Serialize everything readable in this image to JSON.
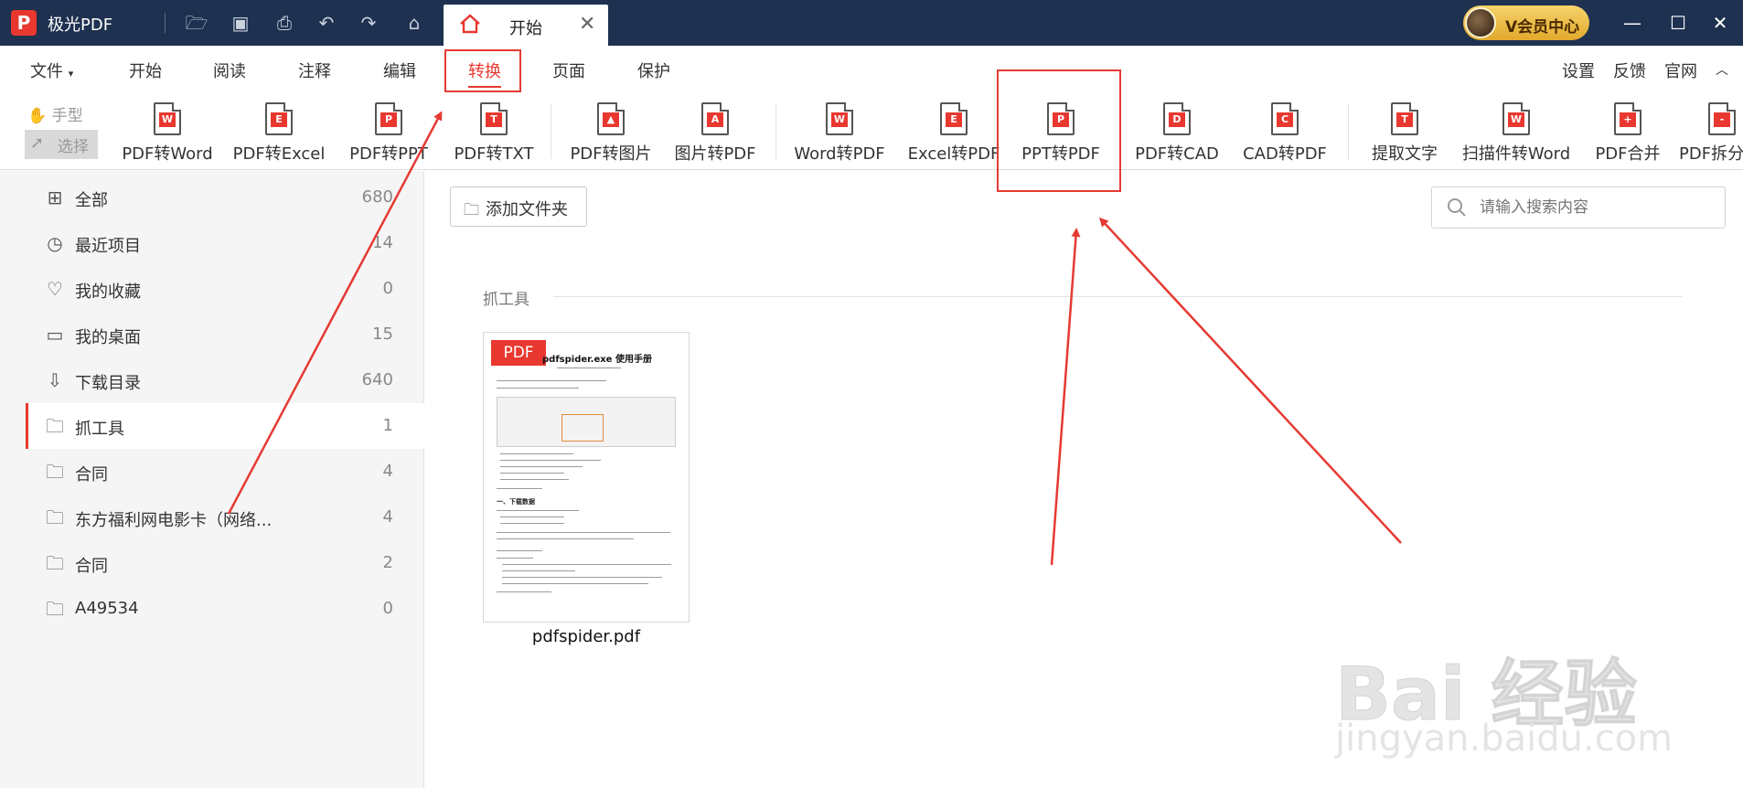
{
  "app": {
    "name": "极光PDF",
    "logo": "P"
  },
  "tabs": [
    {
      "label": "开始",
      "close": "✕"
    }
  ],
  "vip": {
    "label": "会员中心",
    "prefix": "V"
  },
  "menu": {
    "items": [
      "文件",
      "开始",
      "阅读",
      "注释",
      "编辑",
      "转换",
      "页面",
      "保护"
    ],
    "active": "转换",
    "right": [
      "设置",
      "反馈",
      "官网"
    ]
  },
  "toolbar": {
    "hand": "手型",
    "select": "选择",
    "tools": [
      {
        "label": "PDF转Word",
        "badge": "W"
      },
      {
        "label": "PDF转Excel",
        "badge": "E"
      },
      {
        "label": "PDF转PPT",
        "badge": "P"
      },
      {
        "label": "PDF转TXT",
        "badge": "T"
      },
      {
        "label": "PDF转图片",
        "badge": "▲"
      },
      {
        "label": "图片转PDF",
        "badge": "A"
      },
      {
        "label": "Word转PDF",
        "badge": "W"
      },
      {
        "label": "Excel转PDF",
        "badge": "E"
      },
      {
        "label": "PPT转PDF",
        "badge": "P"
      },
      {
        "label": "PDF转CAD",
        "badge": "D"
      },
      {
        "label": "CAD转PDF",
        "badge": "C"
      },
      {
        "label": "提取文字",
        "badge": "T"
      },
      {
        "label": "扫描件转Word",
        "badge": "W"
      },
      {
        "label": "PDF合并",
        "badge": "+"
      },
      {
        "label": "PDF拆分",
        "badge": "-"
      }
    ]
  },
  "sidebar": {
    "items": [
      {
        "label": "全部",
        "count": "680",
        "icon": "grid-icon"
      },
      {
        "label": "最近项目",
        "count": "14",
        "icon": "clock-icon"
      },
      {
        "label": "我的收藏",
        "count": "0",
        "icon": "heart-icon"
      },
      {
        "label": "我的桌面",
        "count": "15",
        "icon": "monitor-icon"
      },
      {
        "label": "下载目录",
        "count": "640",
        "icon": "download-icon"
      },
      {
        "label": "抓工具",
        "count": "1",
        "icon": "folder-clock-icon"
      },
      {
        "label": "合同",
        "count": "4",
        "icon": "folder-clock-icon"
      },
      {
        "label": "东方福利网电影卡（网络...",
        "count": "4",
        "icon": "folder-clock-icon"
      },
      {
        "label": "合同",
        "count": "2",
        "icon": "folder-clock-icon"
      },
      {
        "label": "A49534",
        "count": "0",
        "icon": "folder-clock-icon"
      }
    ],
    "selected_index": 5
  },
  "main": {
    "add_folder": "添加文件夹",
    "search_placeholder": "请输入搜索内容",
    "section": "抓工具",
    "files": [
      {
        "name": "pdfspider.pdf",
        "tag": "PDF",
        "doc_title": "pdfspider.exe 使用手册",
        "doc_heading": "一、下载数据"
      }
    ]
  },
  "watermark": {
    "main": "Bai 经验",
    "sub": "jingyan.baidu.com"
  },
  "colors": {
    "titlebar": "#1e3150",
    "accent": "#e8382f",
    "annotation": "#e53a33"
  }
}
